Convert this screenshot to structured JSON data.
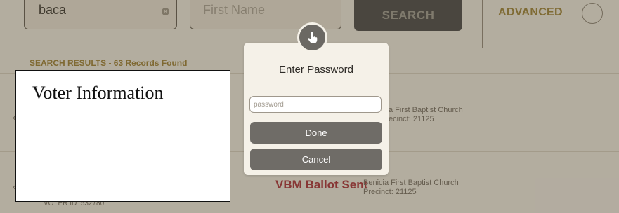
{
  "search": {
    "last_name_value": "baca",
    "first_name_placeholder": "First Name",
    "search_label": "SEARCH",
    "advanced_label": "ADVANCED"
  },
  "results": {
    "header": "SEARCH RESULTS - 63 Records Found",
    "rows": [
      {
        "location": "a First Baptist Church",
        "precinct": "ecinct: 21125"
      },
      {
        "status": "VBM Ballot Sent",
        "location": "Benicia First Baptist Church",
        "precinct": "Precinct: 21125",
        "voter_id": "VOTER ID: 532780"
      }
    ]
  },
  "voter_info": {
    "title": "Voter Information"
  },
  "dialog": {
    "icon": "hand-pointer-icon",
    "title": "Enter Password",
    "password_placeholder": "password",
    "done_label": "Done",
    "cancel_label": "Cancel"
  },
  "colors": {
    "overlay": "#5a503e",
    "dialog_button": "#6f6c67",
    "status_red": "#a8232e",
    "header_gold": "#9a7a2a"
  }
}
